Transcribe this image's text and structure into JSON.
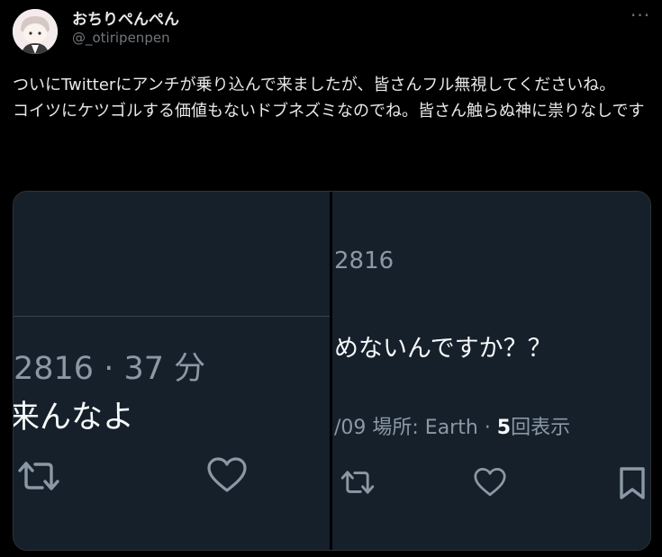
{
  "user": {
    "name": "おちりぺんぺん",
    "handle": "@_otiripenpen"
  },
  "tweet": {
    "text": "ついにTwitterにアンチが乗り込んで来ましたが、皆さんフル無視してくださいね。\nコイツにケツゴルする価値もないドブネズミなのでね。皆さん触らぬ神に祟りなしです"
  },
  "left_panel": {
    "meta": "2816 · 37 分",
    "body": "来んなよ"
  },
  "right_panel": {
    "id": "2816",
    "body": "めないんですか？？",
    "meta_prefix": "/09 場所: Earth · ",
    "views_count": "5",
    "views_label": "回表示"
  },
  "icons": [
    "more-icon",
    "retweet-icon",
    "like-icon",
    "bookmark-icon"
  ]
}
